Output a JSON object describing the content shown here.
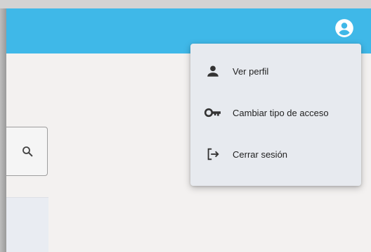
{
  "header": {
    "background_color": "#3fb8e8",
    "account_icon": "account-circle-icon"
  },
  "search": {
    "icon": "search-icon"
  },
  "account_menu": {
    "items": [
      {
        "label": "Ver perfil",
        "icon": "person-icon"
      },
      {
        "label": "Cambiar tipo de acceso",
        "icon": "key-icon"
      },
      {
        "label": "Cerrar sesión",
        "icon": "logout-icon"
      }
    ]
  }
}
